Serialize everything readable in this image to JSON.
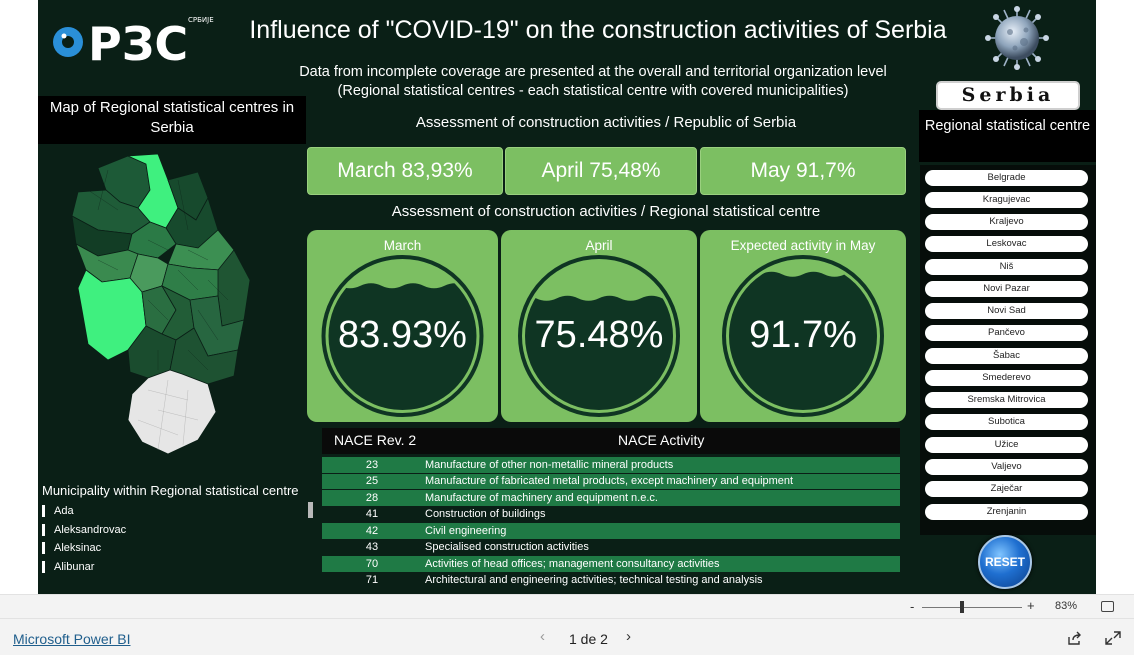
{
  "header": {
    "logo_text": "РЗС",
    "logo_small": "СРБИЈЕ",
    "title": "Influence of \"COVID-19\" on the construction activities of Serbia",
    "subtitle_line1": "Data from incomplete coverage are presented at the overall and territorial organization level",
    "subtitle_line2": "(Regional statistical centres - each statistical centre with covered municipalities)"
  },
  "left_panel": {
    "map_title": "Map of Regional statistical centres in Serbia",
    "municipality_title": "Municipality within Regional statistical centre",
    "municipalities": [
      "Ada",
      "Aleksandrovac",
      "Aleksinac",
      "Alibunar"
    ]
  },
  "kpis": {
    "republic_heading": "Assessment of construction activities / Republic of Serbia",
    "march": "March 83,93%",
    "april": "April 75,48%",
    "may": "May 91,7%",
    "regional_heading": "Assessment of construction activities / Regional statistical centre"
  },
  "gauges": [
    {
      "label": "March",
      "value": "83.93%",
      "fill": 0.8393
    },
    {
      "label": "April",
      "value": "75.48%",
      "fill": 0.7548
    },
    {
      "label": "Expected activity in May",
      "value": "91.7%",
      "fill": 0.917
    }
  ],
  "table": {
    "col_code": "NACE Rev. 2",
    "col_activity": "NACE Activity",
    "rows": [
      {
        "code": "23",
        "activity": "Manufacture of other non-metallic mineral products"
      },
      {
        "code": "25",
        "activity": "Manufacture of fabricated metal products, except machinery and equipment"
      },
      {
        "code": "28",
        "activity": "Manufacture of machinery and equipment n.e.c."
      },
      {
        "code": "41",
        "activity": "Construction of buildings"
      },
      {
        "code": "42",
        "activity": "Civil engineering"
      },
      {
        "code": "43",
        "activity": "Specialised construction activities"
      },
      {
        "code": "70",
        "activity": "Activities of head offices; management consultancy activities"
      },
      {
        "code": "71",
        "activity": "Architectural and engineering activities; technical testing and analysis"
      }
    ]
  },
  "right_panel": {
    "serbia_button": "Serbia",
    "regional_title": "Regional statistical centre",
    "centres": [
      "Belgrade",
      "Kragujevac",
      "Kraljevo",
      "Leskovac",
      "Niš",
      "Novi Pazar",
      "Novi Sad",
      "Pančevo",
      "Šabac",
      "Smederevo",
      "Sremska Mitrovica",
      "Subotica",
      "Užice",
      "Valjevo",
      "Zaječar",
      "Zrenjanin"
    ],
    "reset_label": "RESET"
  },
  "zoom": {
    "minus": "-",
    "plus": "+",
    "level": "83%"
  },
  "footer": {
    "pbi_link": "Microsoft Power BI",
    "prev": "‹",
    "page_indicator": "1 de 2",
    "next": "›"
  },
  "colors": {
    "background": "#0a1f16",
    "kpi_green": "#7cbf62",
    "gauge_dark": "#0f3523",
    "table_row_green": "#1f7a45",
    "highlight_green": "#3ff07f"
  }
}
